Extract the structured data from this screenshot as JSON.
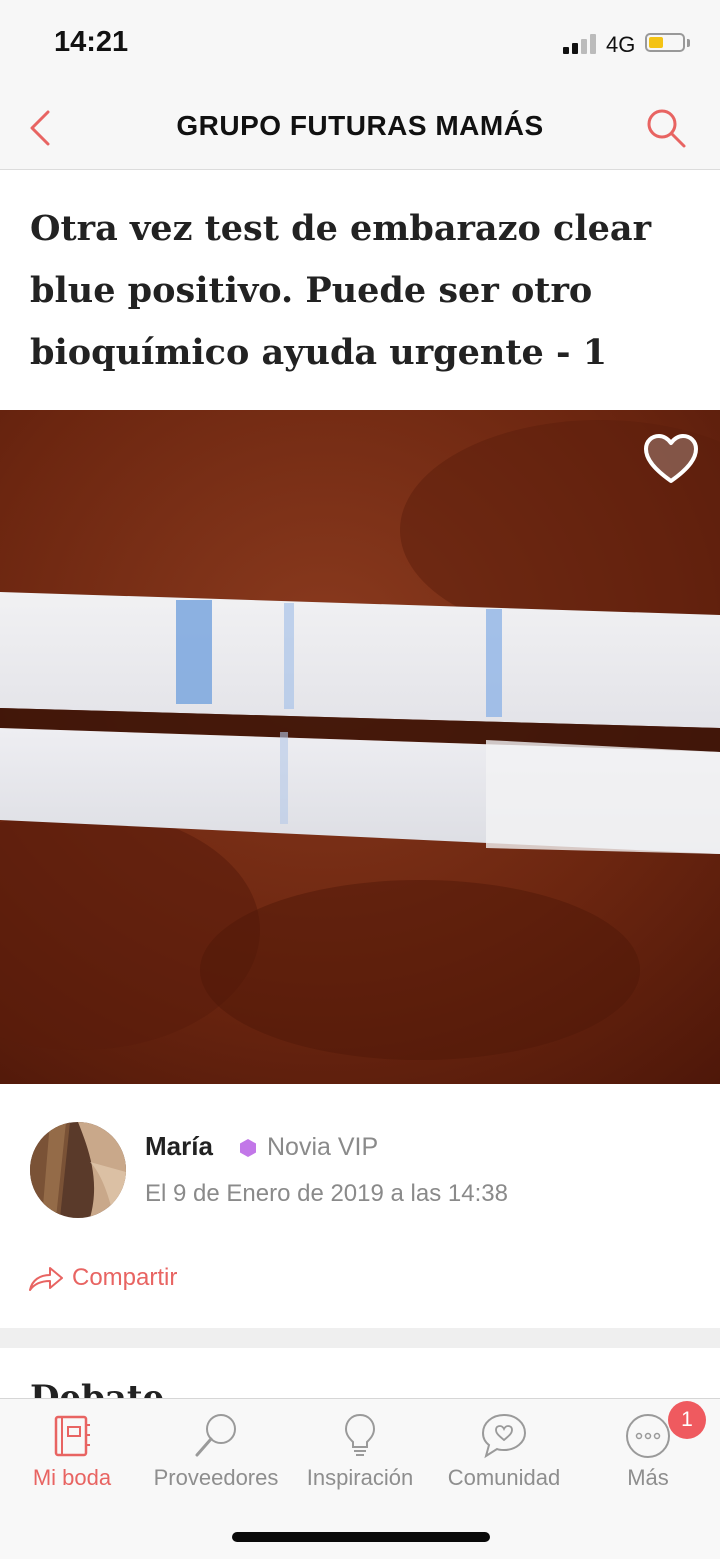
{
  "status_bar": {
    "time": "14:21",
    "network": "4G",
    "battery_color": "#f4c314"
  },
  "nav": {
    "title": "GRUPO FUTURAS MAMÁS",
    "accent": "#e86462"
  },
  "post": {
    "title": "Otra vez test de embarazo clear blue positivo. Puede ser otro bioquímico ayuda urgente - 1",
    "author": {
      "name": "María",
      "badge": "Novia VIP",
      "badge_color": "#c277e8"
    },
    "date": "El 9 de Enero de 2019 a las 14:38",
    "share_label": "Compartir"
  },
  "section": {
    "heading": "Debate"
  },
  "tabs": [
    {
      "label": "Mi boda",
      "icon": "notebook-icon",
      "active": true
    },
    {
      "label": "Proveedores",
      "icon": "magnifier-icon",
      "active": false
    },
    {
      "label": "Inspiración",
      "icon": "lightbulb-icon",
      "active": false
    },
    {
      "label": "Comunidad",
      "icon": "chat-heart-icon",
      "active": false
    },
    {
      "label": "Más",
      "icon": "more-dots-icon",
      "active": false
    }
  ],
  "notification_badge": "1"
}
